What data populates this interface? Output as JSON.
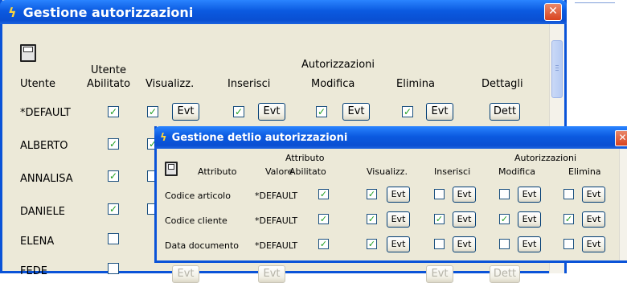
{
  "main": {
    "title": "Gestione autorizzazioni",
    "close_glyph": "✕",
    "headers": {
      "utente": "Utente",
      "utente_abilitato_1": "Utente",
      "utente_abilitato_2": "Abilitato",
      "autorizzazioni": "Autorizzazioni",
      "visualizz": "Visualizz.",
      "inserisci": "Inserisci",
      "modifica": "Modifica",
      "elimina": "Elimina",
      "dettagli": "Dettagli"
    },
    "evt_label": "Evt",
    "dett_label": "Dett",
    "rows": [
      {
        "user": "*DEFAULT",
        "enabled": true,
        "visualizz": true,
        "inserisci": true,
        "modifica": true,
        "elimina": true
      },
      {
        "user": "ALBERTO",
        "enabled": true,
        "visualizz": true
      },
      {
        "user": "ANNALISA",
        "enabled": true,
        "visualizz": false
      },
      {
        "user": "DANIELE",
        "enabled": true,
        "visualizz": false
      },
      {
        "user": "ELENA",
        "enabled": false
      },
      {
        "user": "FEDE",
        "enabled": false
      }
    ]
  },
  "detail": {
    "title": "Gestione detlio autorizzazioni",
    "close_glyph": "✕",
    "headers": {
      "attributo": "Attributo",
      "valore": "Valore",
      "attributo_abilitato_1": "Attributo",
      "attributo_abilitato_2": "Abilitato",
      "autorizzazioni": "Autorizzazioni",
      "visualizz": "Visualizz.",
      "inserisci": "Inserisci",
      "modifica": "Modifica",
      "elimina": "Elimina"
    },
    "evt_label": "Evt",
    "rows": [
      {
        "attributo": "Codice articolo",
        "valore": "*DEFAULT",
        "enabled": true,
        "visualizz": true,
        "inserisci": false,
        "modifica": false,
        "elimina": false
      },
      {
        "attributo": "Codice cliente",
        "valore": "*DEFAULT",
        "enabled": true,
        "visualizz": true,
        "inserisci": true,
        "modifica": true,
        "elimina": true
      },
      {
        "attributo": "Data documento",
        "valore": "*DEFAULT",
        "enabled": true,
        "visualizz": true,
        "inserisci": false,
        "modifica": false,
        "elimina": false
      }
    ]
  },
  "colors": {
    "title_blue": "#0b5ae0",
    "window_bg": "#ece9d8",
    "check_green": "#1f9e1f",
    "close_red": "#d9431e"
  }
}
